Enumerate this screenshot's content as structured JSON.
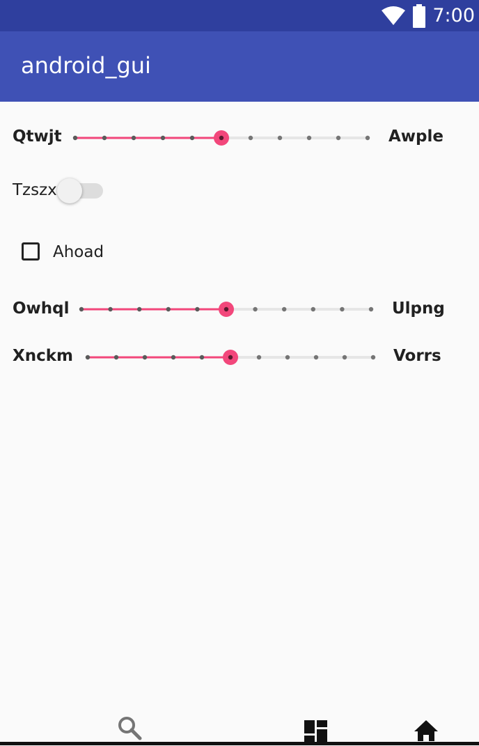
{
  "status_bar": {
    "time": "7:00",
    "icons": [
      "wifi-icon",
      "battery-icon"
    ],
    "color": "#2f3f9e"
  },
  "app_bar": {
    "title": "android_gui",
    "color": "#3f51b5"
  },
  "accent_color": "#f2477b",
  "sliders": [
    {
      "left_label": "Qtwjt",
      "right_label": "Awple",
      "steps": 10,
      "value": 5
    },
    {
      "left_label": "Owhql",
      "right_label": "Ulpng",
      "steps": 10,
      "value": 5
    },
    {
      "left_label": "Xnckm",
      "right_label": "Vorrs",
      "steps": 10,
      "value": 5
    }
  ],
  "switch": {
    "label": "Tzszx",
    "checked": false
  },
  "checkbox": {
    "label": "Ahoad",
    "checked": false
  },
  "bottom_nav": {
    "items": [
      "search-icon",
      "dashboard-icon",
      "home-icon"
    ]
  }
}
